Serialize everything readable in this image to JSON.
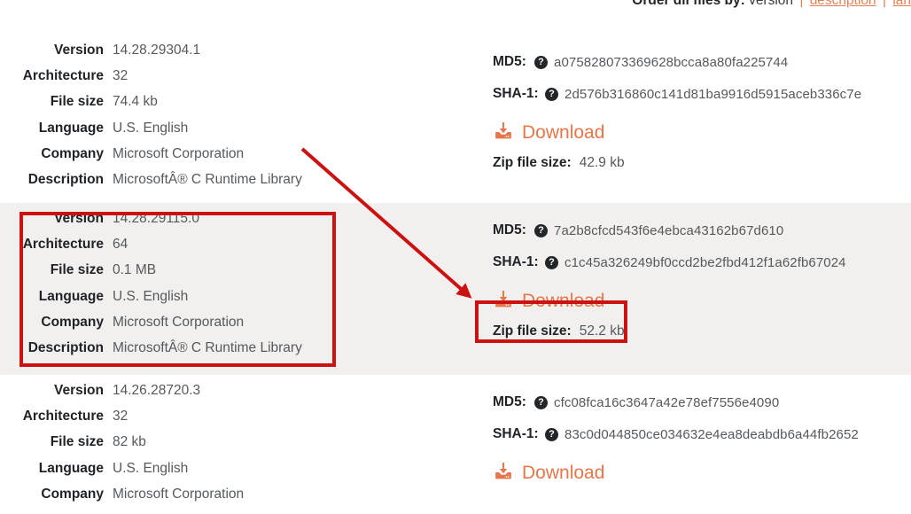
{
  "order_bar": {
    "label": "Order dll files by:",
    "current": "version",
    "separator": "|",
    "links": [
      "description",
      "lan"
    ]
  },
  "labels": {
    "version": "Version",
    "architecture": "Architecture",
    "file_size": "File size",
    "language": "Language",
    "company": "Company",
    "description": "Description",
    "md5": "MD5:",
    "sha1": "SHA-1:",
    "download": "Download",
    "zip_file_size": "Zip file size:",
    "help_icon_glyph": "?"
  },
  "icons": {
    "help": "help-circle-icon",
    "download": "download-icon"
  },
  "colors": {
    "accent_orange": "#e8764a",
    "link_orange": "#e8805a",
    "annotation_red": "#cc1111",
    "row_highlight": "#f2f0ee",
    "text_dark": "#1f2327",
    "text_muted": "#55595d"
  },
  "rows": [
    {
      "version": "14.28.29304.1",
      "architecture": "32",
      "file_size": "74.4 kb",
      "language": "U.S. English",
      "company": "Microsoft Corporation",
      "description": "MicrosoftÂ® C Runtime Library",
      "md5": "a075828073369628bcca8a80fa225744",
      "sha1": "2d576b316860c141d81ba9916d5915aceb336c7e",
      "zip_file_size": "42.9 kb",
      "highlighted": false
    },
    {
      "version": "14.28.29115.0",
      "architecture": "64",
      "file_size": "0.1 MB",
      "language": "U.S. English",
      "company": "Microsoft Corporation",
      "description": "MicrosoftÂ® C Runtime Library",
      "md5": "7a2b8cfcd543f6e4ebca43162b67d610",
      "sha1": "c1c45a326249bf0ccd2be2fbd412f1a62fb67024",
      "zip_file_size": "52.2 kb",
      "highlighted": true
    },
    {
      "version": "14.26.28720.3",
      "architecture": "32",
      "file_size": "82 kb",
      "language": "U.S. English",
      "company": "Microsoft Corporation",
      "description": "",
      "md5": "cfc08fca16c3647a42e78ef7556e4090",
      "sha1": "83c0d044850ce034632e4ea8deabdb6a44fb2652",
      "zip_file_size": "",
      "highlighted": false
    }
  ]
}
